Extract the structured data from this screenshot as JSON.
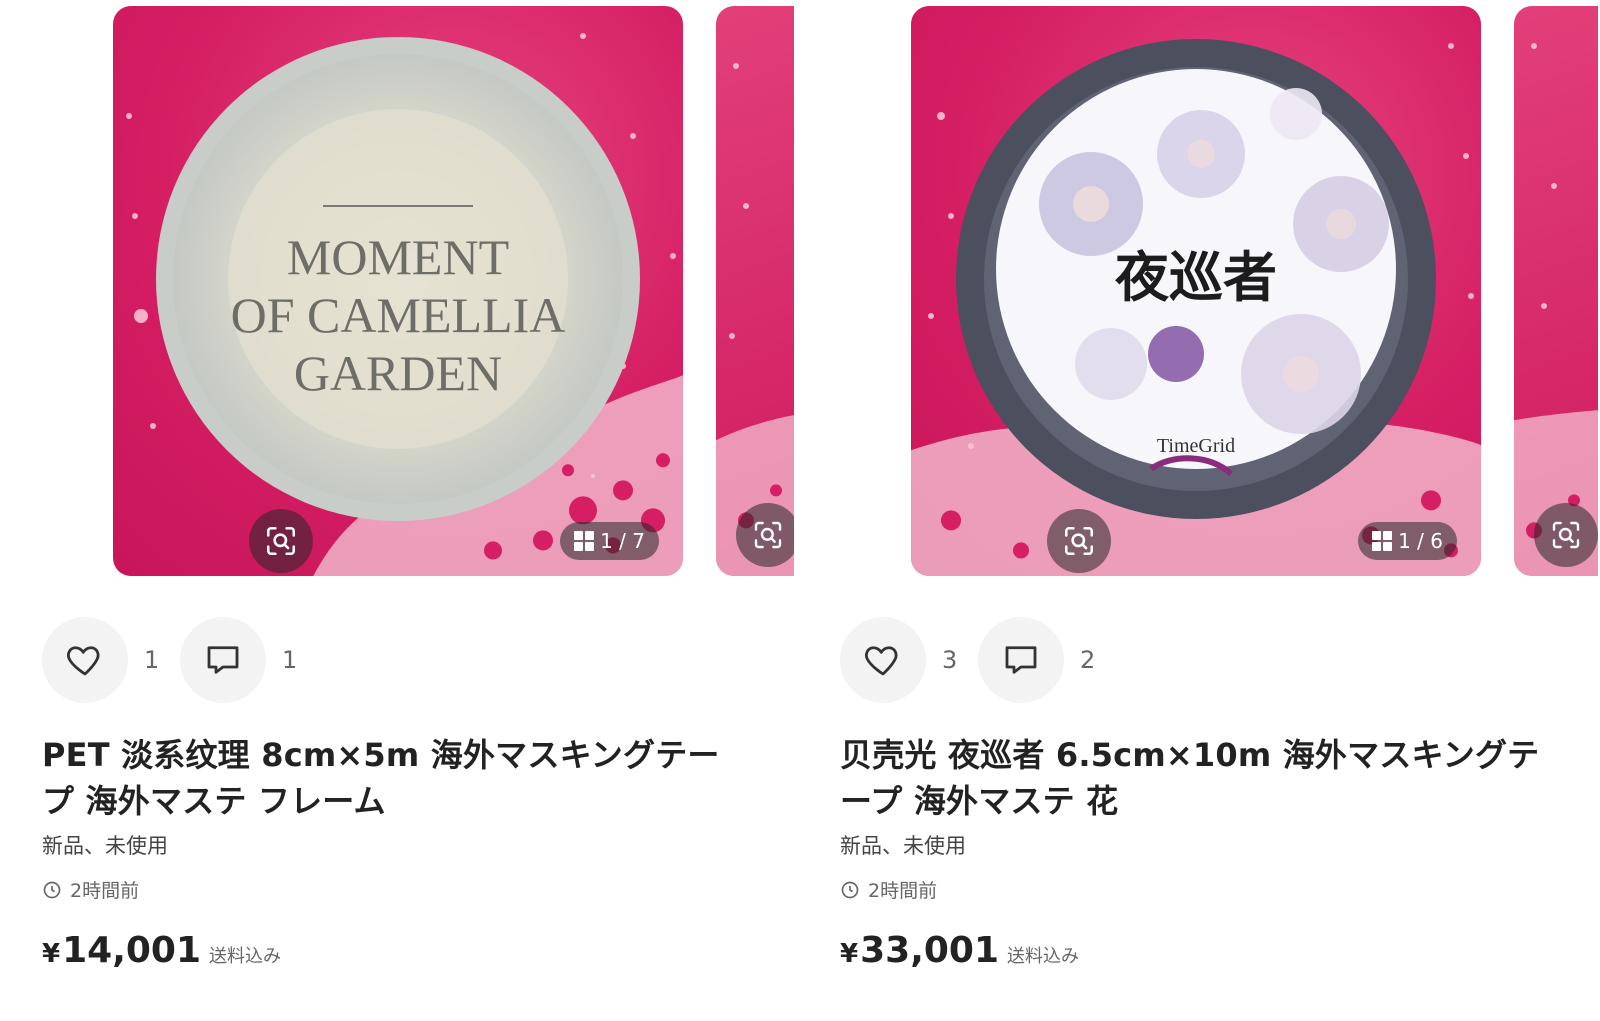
{
  "colors": {
    "photo_bg": "#d51e63",
    "text": "#222222",
    "muted": "#666666",
    "button_bg": "#f3f3f3"
  },
  "listings": [
    {
      "image_text": {
        "tape_lines": [
          "MOMENT",
          "OF CAMELLIA",
          "GARDEN"
        ]
      },
      "image_counter": "1 / 7",
      "likes": "1",
      "comments": "1",
      "title": "PET 淡系纹理 8cm×5m 海外マスキングテープ 海外マステ フレーム",
      "condition": "新品、未使用",
      "posted": "2時間前",
      "currency": "¥",
      "price": "14,001",
      "shipping": "送料込み"
    },
    {
      "image_text": {
        "tape_title": "夜巡者",
        "brand": "TimeGrid"
      },
      "image_counter": "1 / 6",
      "likes": "3",
      "comments": "2",
      "title": "贝壳光 夜巡者 6.5cm×10m 海外マスキングテープ 海外マステ 花",
      "condition": "新品、未使用",
      "posted": "2時間前",
      "currency": "¥",
      "price": "33,001",
      "shipping": "送料込み"
    }
  ],
  "icons": [
    "heart-icon",
    "comment-icon",
    "zoom-scan-icon",
    "gallery-grid-icon",
    "clock-icon"
  ]
}
